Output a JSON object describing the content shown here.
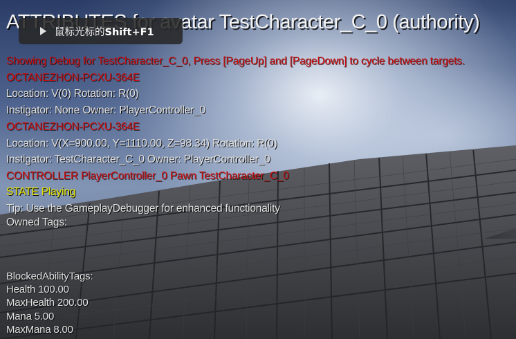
{
  "title": "ATTRIBUTES for avatar TestCharacter_C_0 (authority)",
  "tooltip": {
    "text": "鼠标光标的",
    "shortcut": "Shift+F1"
  },
  "debug_lines": [
    {
      "text": "Showing Debug for TestCharacter_C_0, Press [PageUp] and [PageDown] to cycle between targets.",
      "style": "red"
    },
    {
      "text": "OCTANEZHON-PCXU-364E",
      "style": "red"
    },
    {
      "text": "Location: V(0) Rotation: R(0)",
      "style": "white"
    },
    {
      "text": " Instigator: None Owner: PlayerController_0",
      "style": "white"
    },
    {
      "text": "OCTANEZHON-PCXU-364E",
      "style": "red"
    },
    {
      "text": "Location: V(X=900.00, Y=1110.00, Z=98.34) Rotation: R(0)",
      "style": "white"
    },
    {
      "text": " Instigator: TestCharacter_C_0 Owner: PlayerController_0",
      "style": "white"
    },
    {
      "text": "CONTROLLER PlayerController_0 Pawn TestCharacter_C_0",
      "style": "red"
    },
    {
      "text": "STATE Playing",
      "style": "yellow"
    },
    {
      "text": "Tip: Use the GameplayDebugger for enhanced functionality",
      "style": "white"
    },
    {
      "text": "Owned Tags:",
      "style": "white"
    }
  ],
  "attributes": [
    {
      "text": "BlockedAbilityTags:"
    },
    {
      "text": "Health 100.00"
    },
    {
      "text": "MaxHealth 200.00"
    },
    {
      "text": "Mana 5.00"
    },
    {
      "text": "MaxMana 8.00"
    }
  ]
}
